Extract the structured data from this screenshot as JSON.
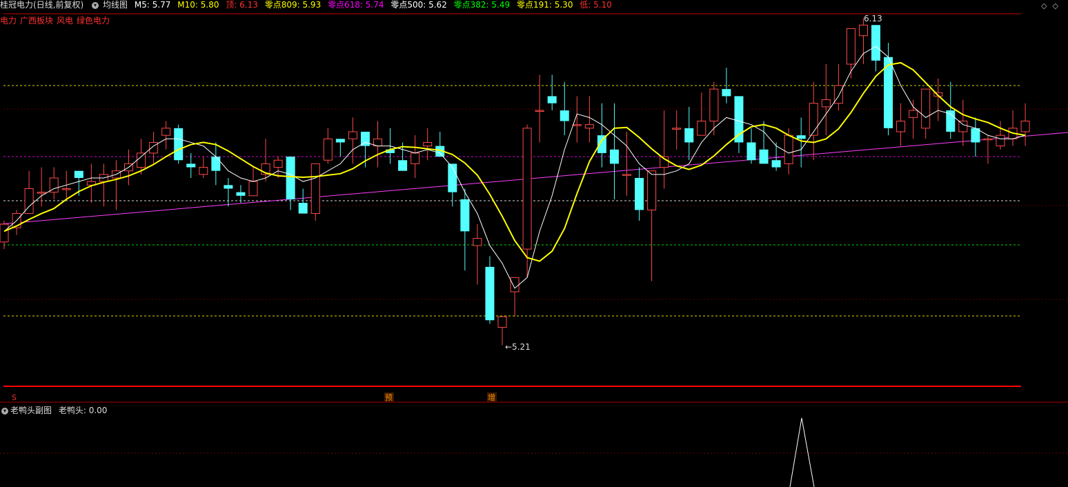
{
  "header": {
    "stock_name": "桂冠电力",
    "period": "(日线,前复权)",
    "ma_menu": "均线图",
    "m5_label": "M5: 5.77",
    "m10_label": "M10: 5.80",
    "top_label": "顶: 6.13",
    "z809_label": "零点809: 5.93",
    "z618_label": "零点618: 5.74",
    "z500_label": "零点500: 5.62",
    "z382_label": "零点382: 5.49",
    "z191_label": "零点191: 5.30",
    "low_label": "低: 5.10",
    "colors": {
      "m5": "#ffffff",
      "m10": "#ffff00",
      "top": "#ff3030",
      "z809": "#ffff00",
      "z618": "#ff00ff",
      "z500": "#ffffff",
      "z382": "#00ff00",
      "z191": "#ffff00",
      "low": "#ff3030"
    }
  },
  "tags": [
    "电力",
    "广西板块",
    "风电",
    "绿色电力"
  ],
  "top_right_icons": [
    "chevron-left-icon",
    "chevron-up-icon"
  ],
  "annotations": {
    "high": "6.13",
    "low": "←5.21"
  },
  "markers": {
    "s": "S",
    "yu": "预",
    "zeng": "增"
  },
  "subchart": {
    "title": "老鸭头副图",
    "value_label": "老鸭头: 0.00"
  },
  "chart_data": {
    "type": "candlestick",
    "ylim": [
      5.1,
      6.13
    ],
    "levels": [
      {
        "name": "零点809",
        "value": 5.93,
        "color": "#ffff00"
      },
      {
        "name": "零点618",
        "value": 5.74,
        "color": "#ff00ff"
      },
      {
        "name": "零点500",
        "value": 5.62,
        "color": "#ffffff"
      },
      {
        "name": "零点382",
        "value": 5.49,
        "color": "#00ff00"
      },
      {
        "name": "零点191",
        "value": 5.3,
        "color": "#ffff00"
      }
    ],
    "candles": [
      [
        5.5,
        5.55,
        5.56,
        5.48
      ],
      [
        5.54,
        5.58,
        5.59,
        5.52
      ],
      [
        5.58,
        5.65,
        5.7,
        5.58
      ],
      [
        5.64,
        5.64,
        5.71,
        5.6
      ],
      [
        5.64,
        5.68,
        5.71,
        5.62
      ],
      [
        5.65,
        5.65,
        5.7,
        5.62
      ],
      [
        5.7,
        5.68,
        5.7,
        5.63
      ],
      [
        5.66,
        5.67,
        5.72,
        5.61
      ],
      [
        5.67,
        5.69,
        5.72,
        5.6
      ],
      [
        5.68,
        5.7,
        5.73,
        5.59
      ],
      [
        5.7,
        5.72,
        5.76,
        5.66
      ],
      [
        5.71,
        5.75,
        5.79,
        5.69
      ],
      [
        5.75,
        5.78,
        5.81,
        5.72
      ],
      [
        5.8,
        5.82,
        5.84,
        5.76
      ],
      [
        5.82,
        5.73,
        5.83,
        5.72
      ],
      [
        5.72,
        5.71,
        5.75,
        5.68
      ],
      [
        5.69,
        5.71,
        5.74,
        5.68
      ],
      [
        5.74,
        5.7,
        5.78,
        5.66
      ],
      [
        5.66,
        5.65,
        5.68,
        5.6
      ],
      [
        5.64,
        5.63,
        5.66,
        5.61
      ],
      [
        5.63,
        5.67,
        5.71,
        5.63
      ],
      [
        5.69,
        5.72,
        5.79,
        5.67
      ],
      [
        5.71,
        5.73,
        5.74,
        5.68
      ],
      [
        5.74,
        5.62,
        5.74,
        5.59
      ],
      [
        5.61,
        5.58,
        5.65,
        5.58
      ],
      [
        5.58,
        5.72,
        5.72,
        5.56
      ],
      [
        5.73,
        5.79,
        5.82,
        5.72
      ],
      [
        5.79,
        5.78,
        5.78,
        5.74
      ],
      [
        5.79,
        5.81,
        5.85,
        5.72
      ],
      [
        5.81,
        5.77,
        5.81,
        5.71
      ],
      [
        5.77,
        5.79,
        5.84,
        5.71
      ],
      [
        5.76,
        5.75,
        5.82,
        5.72
      ],
      [
        5.73,
        5.7,
        5.78,
        5.7
      ],
      [
        5.72,
        5.75,
        5.8,
        5.68
      ],
      [
        5.77,
        5.78,
        5.82,
        5.73
      ],
      [
        5.77,
        5.74,
        5.81,
        5.74
      ],
      [
        5.72,
        5.64,
        5.72,
        5.6
      ],
      [
        5.62,
        5.53,
        5.65,
        5.42
      ],
      [
        5.49,
        5.51,
        5.55,
        5.38
      ],
      [
        5.43,
        5.28,
        5.46,
        5.27
      ],
      [
        5.26,
        5.29,
        5.21,
        5.21
      ],
      [
        5.36,
        5.4,
        5.39,
        5.29
      ],
      [
        5.48,
        5.82,
        5.83,
        5.4
      ],
      [
        5.87,
        5.87,
        5.97,
        5.78
      ],
      [
        5.91,
        5.89,
        5.97,
        5.87
      ],
      [
        5.87,
        5.84,
        5.95,
        5.8
      ],
      [
        5.83,
        5.83,
        5.91,
        5.78
      ],
      [
        5.82,
        5.83,
        5.91,
        5.78
      ],
      [
        5.8,
        5.75,
        5.89,
        5.71
      ],
      [
        5.76,
        5.72,
        5.89,
        5.62
      ],
      [
        5.69,
        5.69,
        5.81,
        5.63
      ],
      [
        5.68,
        5.59,
        5.71,
        5.56
      ],
      [
        5.59,
        5.7,
        5.62,
        5.39
      ],
      [
        5.71,
        5.74,
        5.87,
        5.65
      ],
      [
        5.82,
        5.82,
        5.87,
        5.76
      ],
      [
        5.82,
        5.78,
        5.88,
        5.73
      ],
      [
        5.8,
        5.84,
        5.92,
        5.8
      ],
      [
        5.84,
        5.93,
        5.95,
        5.8
      ],
      [
        5.93,
        5.91,
        5.99,
        5.89
      ],
      [
        5.91,
        5.78,
        5.91,
        5.75
      ],
      [
        5.78,
        5.73,
        5.82,
        5.72
      ],
      [
        5.76,
        5.72,
        5.84,
        5.73
      ],
      [
        5.73,
        5.71,
        5.78,
        5.7
      ],
      [
        5.72,
        5.8,
        5.82,
        5.69
      ],
      [
        5.8,
        5.79,
        5.85,
        5.71
      ],
      [
        5.8,
        5.89,
        5.95,
        5.73
      ],
      [
        5.88,
        5.9,
        6.0,
        5.8
      ],
      [
        5.89,
        5.94,
        6.0,
        5.87
      ],
      [
        6.0,
        6.1,
        6.1,
        5.96
      ],
      [
        6.08,
        6.11,
        6.13,
        6.0
      ],
      [
        6.11,
        6.01,
        6.1,
        5.98
      ],
      [
        6.02,
        5.82,
        6.06,
        5.8
      ],
      [
        5.81,
        5.84,
        5.89,
        5.77
      ],
      [
        5.85,
        5.87,
        5.9,
        5.79
      ],
      [
        5.82,
        5.93,
        5.93,
        5.79
      ],
      [
        5.91,
        5.92,
        5.96,
        5.84
      ],
      [
        5.87,
        5.81,
        5.95,
        5.79
      ],
      [
        5.81,
        5.84,
        5.9,
        5.77
      ],
      [
        5.82,
        5.78,
        5.85,
        5.74
      ],
      [
        5.79,
        5.79,
        5.8,
        5.72
      ],
      [
        5.77,
        5.8,
        5.84,
        5.76
      ],
      [
        5.79,
        5.82,
        5.87,
        5.77
      ],
      [
        5.81,
        5.84,
        5.89,
        5.77
      ]
    ],
    "ma5": [
      5.53,
      5.56,
      5.6,
      5.63,
      5.65,
      5.66,
      5.67,
      5.68,
      5.68,
      5.69,
      5.71,
      5.74,
      5.77,
      5.79,
      5.79,
      5.78,
      5.77,
      5.74,
      5.7,
      5.68,
      5.67,
      5.68,
      5.7,
      5.69,
      5.67,
      5.68,
      5.7,
      5.72,
      5.76,
      5.78,
      5.77,
      5.77,
      5.76,
      5.75,
      5.76,
      5.75,
      5.71,
      5.64,
      5.58,
      5.49,
      5.44,
      5.37,
      5.4,
      5.53,
      5.63,
      5.76,
      5.86,
      5.85,
      5.83,
      5.8,
      5.77,
      5.72,
      5.69,
      5.69,
      5.7,
      5.72,
      5.78,
      5.82,
      5.85,
      5.84,
      5.83,
      5.81,
      5.77,
      5.75,
      5.76,
      5.81,
      5.86,
      5.91,
      5.98,
      6.03,
      6.05,
      6.02,
      5.94,
      5.88,
      5.85,
      5.87,
      5.86,
      5.83,
      5.82,
      5.8,
      5.79,
      5.79,
      5.8
    ]
  }
}
